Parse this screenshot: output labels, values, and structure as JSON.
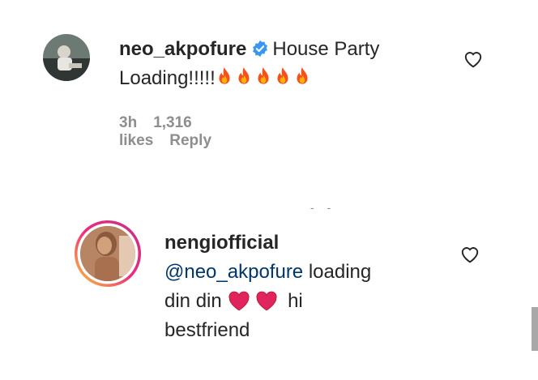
{
  "comments": [
    {
      "username": "neo_akpofure",
      "verified": true,
      "text_before": "House Party",
      "text_line2": "Loading!!!!!",
      "emoji": "fire",
      "emoji_count": 5,
      "time": "3h",
      "likes": "1,316 likes",
      "reply": "Reply"
    },
    {
      "username": "nengiofficial",
      "mention": "@neo_akpofure",
      "text_after_mention": " loading",
      "text_line2": "din din",
      "emoji": "red-heart",
      "emoji_count": 2,
      "text_after_emoji": " hi",
      "text_line3": "bestfriend"
    }
  ],
  "colors": {
    "text": "#262626",
    "meta": "#8e8e8e",
    "mention": "#00376b",
    "verified": "#3897f0",
    "story_ring_start": "#f9ce34",
    "story_ring_end": "#ee2a7b"
  }
}
